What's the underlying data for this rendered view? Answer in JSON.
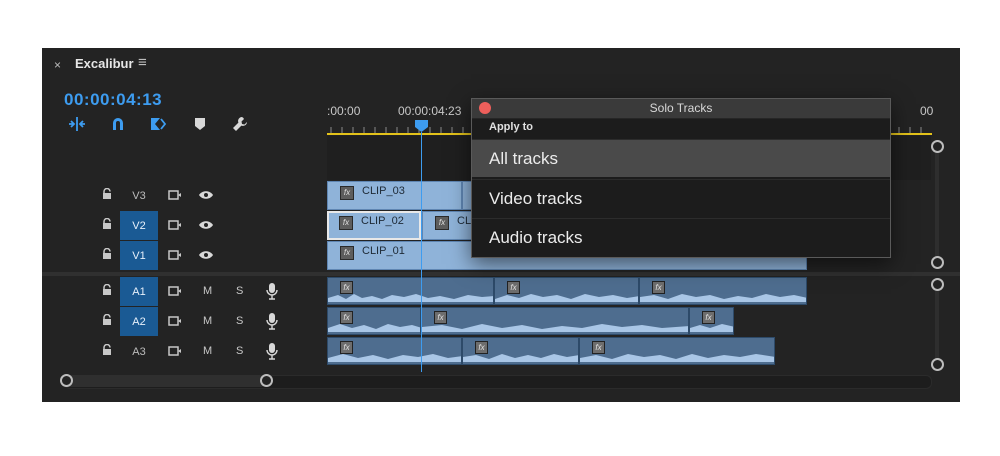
{
  "window": {
    "close_glyph": "×",
    "title": "Excalibur",
    "menu_glyph": "≡"
  },
  "timecode": "00:00:04:13",
  "toolbar": {
    "tools": [
      "insert-snap-icon",
      "linked-selection-icon",
      "add-marker-icon",
      "marker-icon",
      "wrench-icon"
    ]
  },
  "ruler": {
    "labels": [
      ":00:00",
      "00:00:04:23",
      "00"
    ]
  },
  "tracks": {
    "video": [
      {
        "name": "V3",
        "active": false
      },
      {
        "name": "V2",
        "active": true
      },
      {
        "name": "V1",
        "active": true
      }
    ],
    "audio": [
      {
        "name": "A1",
        "active": true,
        "mute": "M",
        "solo": "S"
      },
      {
        "name": "A2",
        "active": true,
        "mute": "M",
        "solo": "S"
      },
      {
        "name": "A3",
        "active": false,
        "mute": "M",
        "solo": "S"
      }
    ]
  },
  "clips": {
    "fx_label": "fx",
    "v3": "CLIP_03",
    "v2": "CLIP_02",
    "v2b": "CL",
    "v1": "CLIP_01"
  },
  "popup": {
    "title": "Solo Tracks",
    "section": "Apply to",
    "options": [
      {
        "label": "All tracks",
        "selected": true
      },
      {
        "label": "Video tracks",
        "selected": false
      },
      {
        "label": "Audio tracks",
        "selected": false
      }
    ]
  },
  "colors": {
    "accent": "#3d9cf0",
    "track_active": "#1a5a94",
    "ruler_bar": "#e3c21a",
    "video_clip": "#8fb3d9",
    "audio_clip": "#4e6d8f"
  }
}
